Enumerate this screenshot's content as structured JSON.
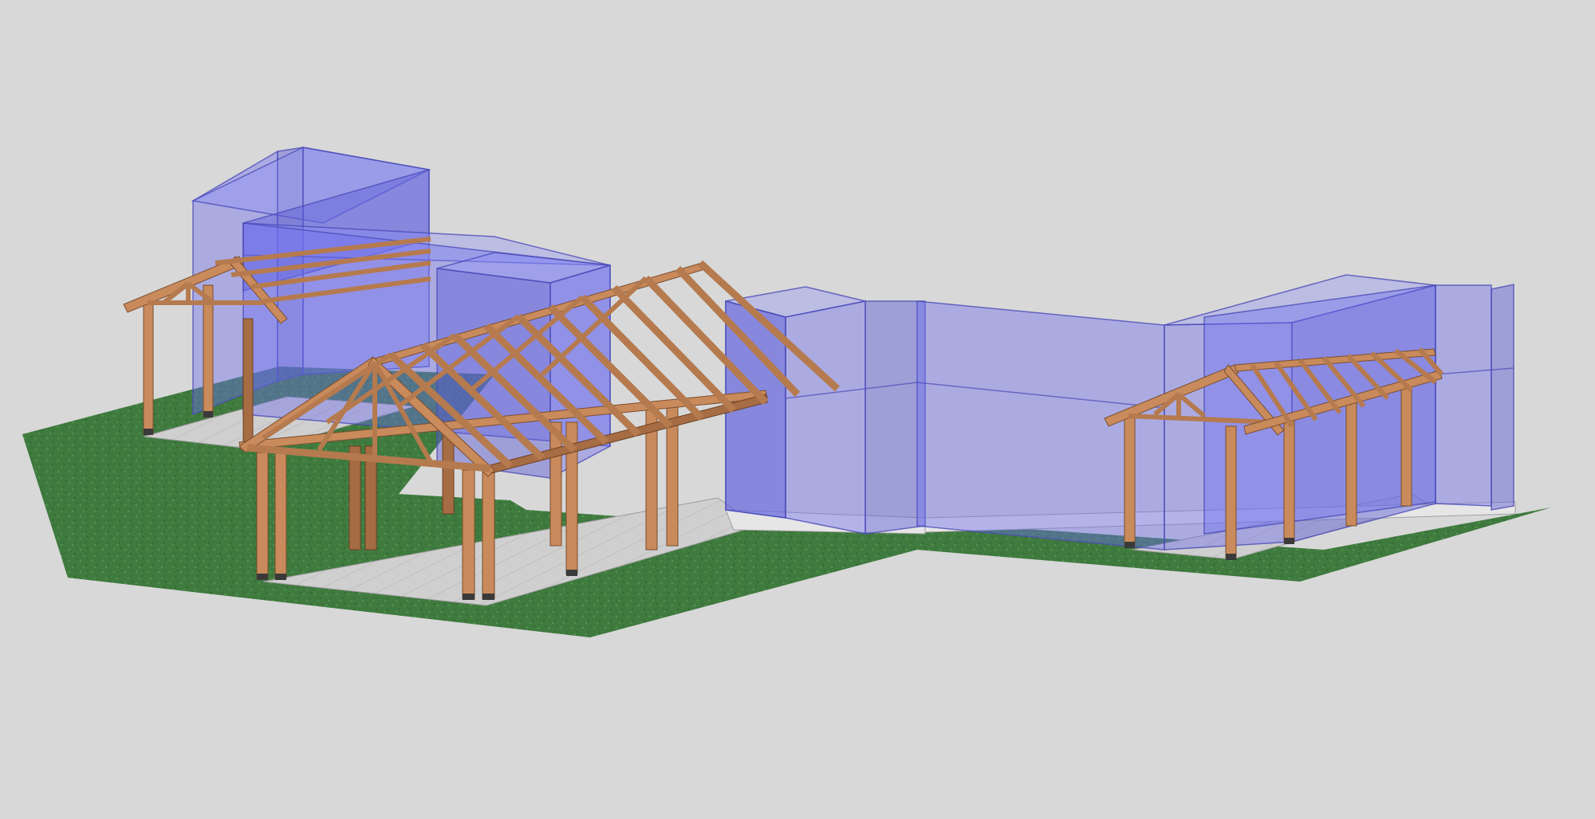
{
  "scene": {
    "background_color": "#d8d8d8",
    "colors": {
      "building_volume": "#6d6ef0",
      "timber": "#c98a5c",
      "grass": "#3f7a3e",
      "slab": "#c9c9c9"
    },
    "objects": [
      "massing-volumes",
      "left-pavilion",
      "center-pavilion",
      "right-pavilion",
      "grass-lawn",
      "concrete-slabs"
    ]
  }
}
